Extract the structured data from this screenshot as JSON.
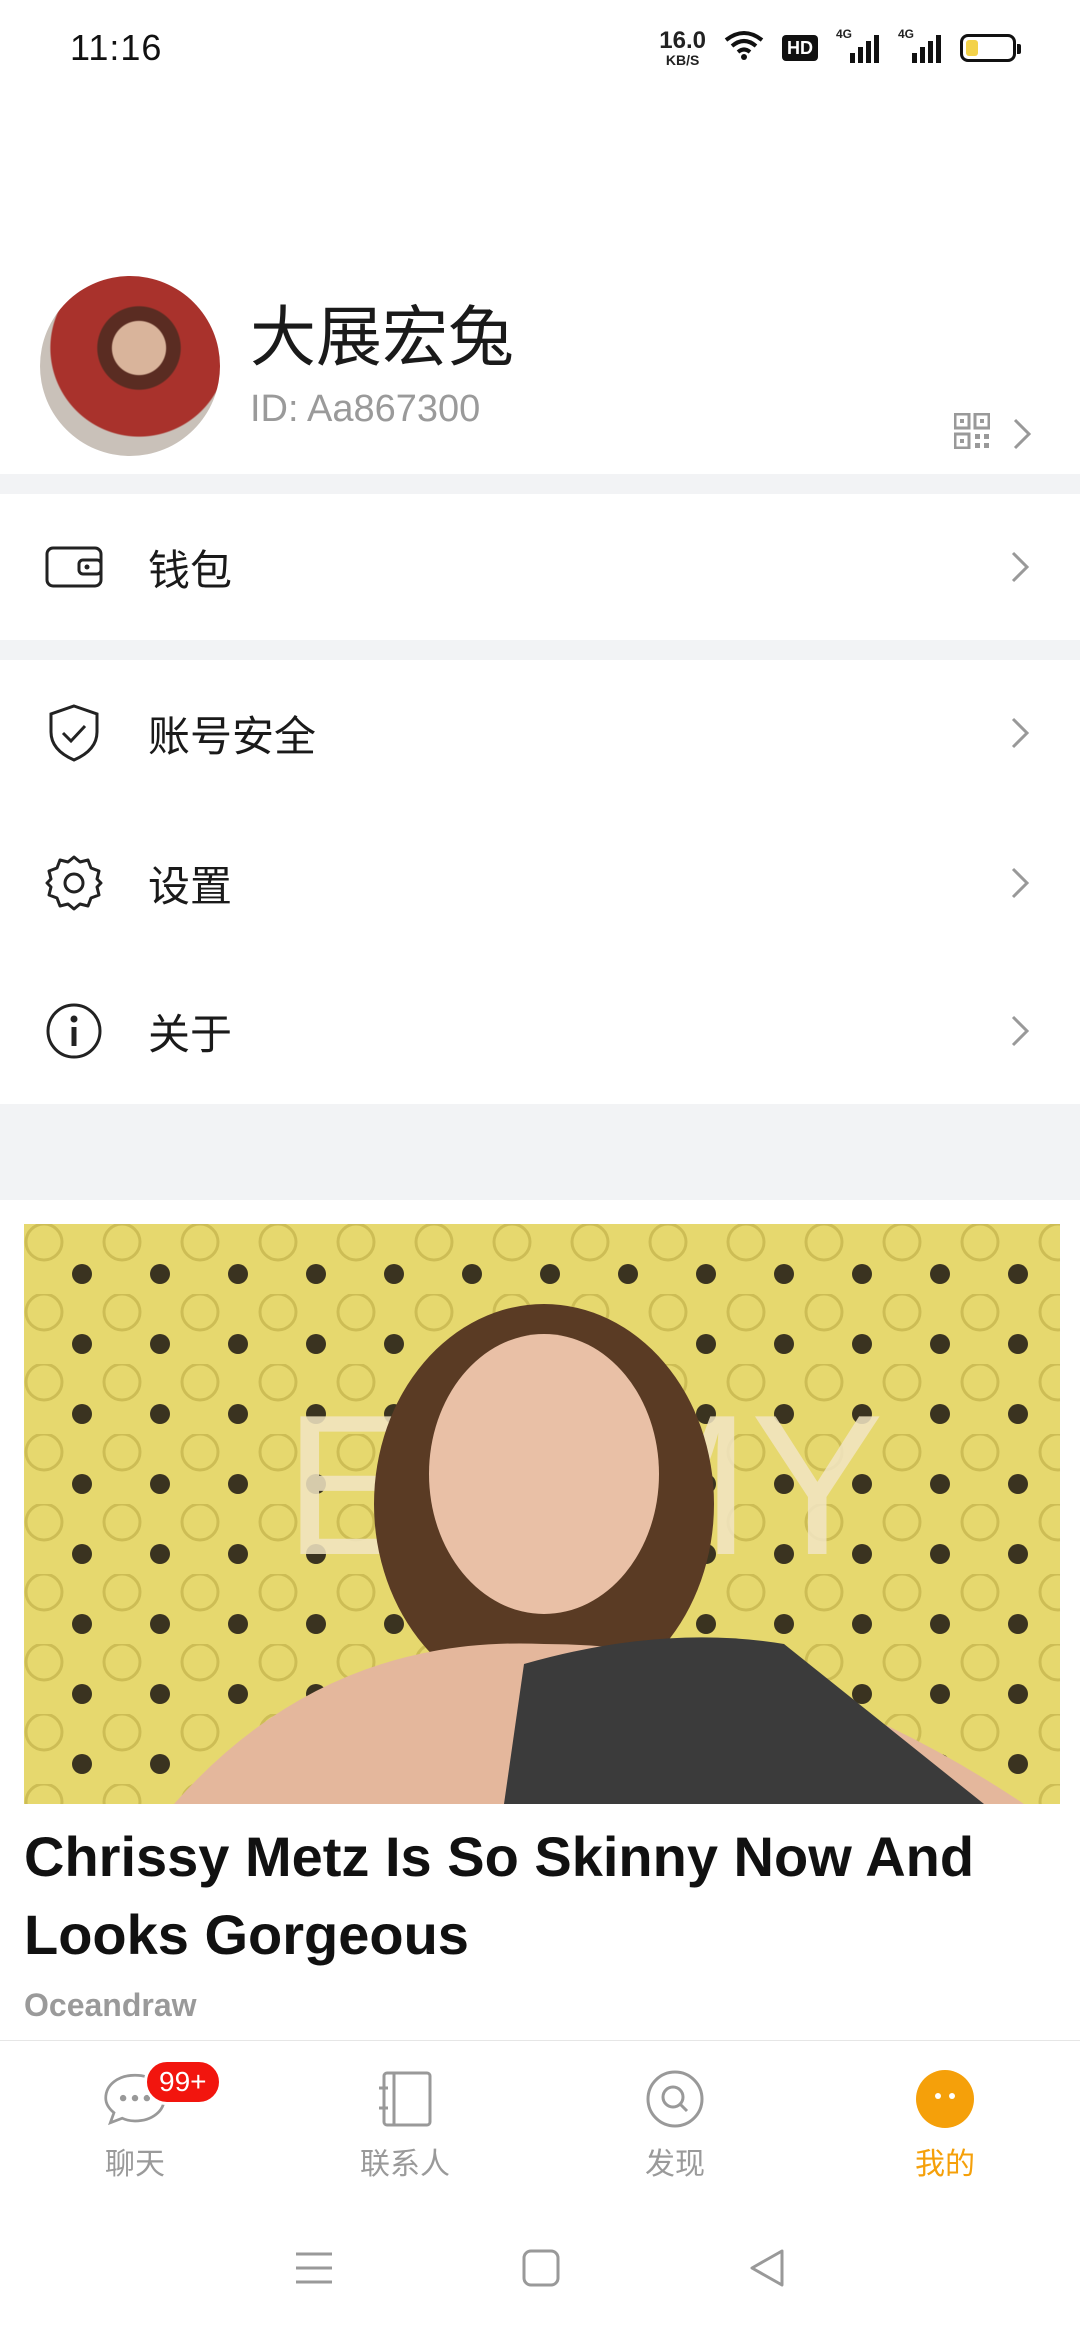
{
  "status_bar": {
    "time": "11:16",
    "net_speed_value": "16.0",
    "net_speed_unit": "KB/S",
    "hd_label": "HD",
    "sig1_label": "4G",
    "sig2_label": "4G"
  },
  "profile": {
    "name": "大展宏兔",
    "id": "ID: Aa867300"
  },
  "menu": {
    "wallet": "钱包",
    "account_security": "账号安全",
    "settings": "设置",
    "about": "关于"
  },
  "ad": {
    "image_text": "EMMY",
    "title": "Chrissy Metz Is So Skinny Now And Looks Gorgeous",
    "source": "Oceandraw"
  },
  "bottom_nav": {
    "chat": "聊天",
    "chat_badge": "99+",
    "contacts": "联系人",
    "discover": "发现",
    "me": "我的"
  },
  "colors": {
    "accent": "#f5a00a",
    "badge": "#f2150e",
    "divider": "#f2f3f5"
  }
}
